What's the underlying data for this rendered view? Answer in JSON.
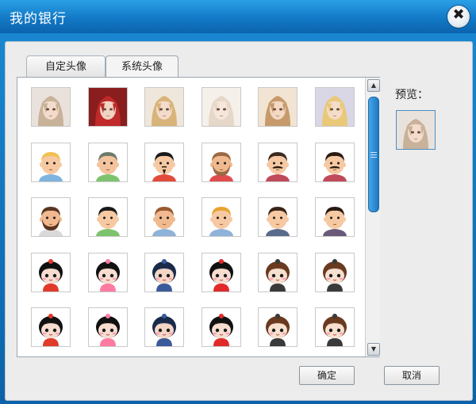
{
  "window": {
    "title": "我的银行",
    "close_glyph": "✖"
  },
  "tabs": [
    {
      "label": "自定头像",
      "active": false
    },
    {
      "label": "系统头像",
      "active": true
    }
  ],
  "preview": {
    "label": "预览："
  },
  "buttons": {
    "ok": "确定",
    "cancel": "取消"
  },
  "scrollbar": {
    "up_glyph": "▲",
    "down_glyph": "▼"
  },
  "avatars": [
    {
      "style": "anime",
      "skin": "#f3dccb",
      "hair": "#c8b29a",
      "bg": "#e9e2dc"
    },
    {
      "style": "anime",
      "skin": "#f1d3c2",
      "hair": "#c02a2a",
      "bg": "#8a1d1d"
    },
    {
      "style": "anime",
      "skin": "#f3dccb",
      "hair": "#d8b37a",
      "bg": "#efe7dc"
    },
    {
      "style": "anime",
      "skin": "#f6e6dc",
      "hair": "#e6d8c8",
      "bg": "#f5f0ea"
    },
    {
      "style": "anime",
      "skin": "#f3d9c4",
      "hair": "#c79a6c",
      "bg": "#f1e4d2"
    },
    {
      "style": "anime",
      "skin": "#f3ddc9",
      "hair": "#e9c978",
      "bg": "#d9d6e6"
    },
    {
      "style": "man",
      "skin": "#f6c9a3",
      "hair": "#f0c050",
      "shirt": "#7fb3e0",
      "facial": "none"
    },
    {
      "style": "man",
      "skin": "#f3c39d",
      "hair": "#6d7a6a",
      "shirt": "#7dc36e",
      "facial": "none"
    },
    {
      "style": "man",
      "skin": "#f6c9a3",
      "hair": "#1a1a1a",
      "shirt": "#e24b3a",
      "facial": "goatee"
    },
    {
      "style": "man",
      "skin": "#f0b98f",
      "hair": "#9a6a44",
      "shirt": "#e04c4c",
      "facial": "beard"
    },
    {
      "style": "man",
      "skin": "#f6c9a3",
      "hair": "#3a2a20",
      "shirt": "#c04a5a",
      "facial": "mustache"
    },
    {
      "style": "man",
      "skin": "#f6c9a3",
      "hair": "#2a1a12",
      "shirt": "#c04a5a",
      "facial": "mustache"
    },
    {
      "style": "man",
      "skin": "#f0b98f",
      "hair": "#5a3620",
      "shirt": "#d9d9d9",
      "facial": "beard"
    },
    {
      "style": "man",
      "skin": "#f6c9a3",
      "hair": "#1a1a1a",
      "shirt": "#7dc36e",
      "facial": "none"
    },
    {
      "style": "man",
      "skin": "#f0b98f",
      "hair": "#9a5a30",
      "shirt": "#8fb2d8",
      "facial": "none"
    },
    {
      "style": "man",
      "skin": "#f6c9a3",
      "hair": "#e8a330",
      "shirt": "#8fb2d8",
      "facial": "none"
    },
    {
      "style": "man",
      "skin": "#f6c9a3",
      "hair": "#3a2418",
      "shirt": "#5a6a8a",
      "facial": "none"
    },
    {
      "style": "man",
      "skin": "#f6c9a3",
      "hair": "#2a1a12",
      "shirt": "#6a5a7a",
      "facial": "none"
    },
    {
      "style": "chibi",
      "skin": "#f7ddd0",
      "hair": "#111111",
      "accent": "#e03a2a",
      "bg": "#ffffff"
    },
    {
      "style": "chibi",
      "skin": "#f7ddd0",
      "hair": "#111111",
      "accent": "#ff7aa0",
      "bg": "#ffffff"
    },
    {
      "style": "chibi",
      "skin": "#f4d6c6",
      "hair": "#1a2a4a",
      "accent": "#3a5a9a",
      "bg": "#ffffff"
    },
    {
      "style": "chibi",
      "skin": "#f7ddd0",
      "hair": "#111111",
      "accent": "#e02a2a",
      "bg": "#ffffff"
    },
    {
      "style": "chibi",
      "skin": "#f7e0cf",
      "hair": "#6a3a20",
      "accent": "#3a3a3a",
      "bg": "#ffffff"
    },
    {
      "style": "chibi",
      "skin": "#f7e0cf",
      "hair": "#6a3a20",
      "accent": "#3a3a3a",
      "bg": "#ffffff"
    },
    {
      "style": "chibi",
      "skin": "#f7ddd0",
      "hair": "#111111",
      "accent": "#e03a2a",
      "bg": "#ffffff"
    },
    {
      "style": "chibi",
      "skin": "#f7ddd0",
      "hair": "#111111",
      "accent": "#ff7aa0",
      "bg": "#ffffff"
    },
    {
      "style": "chibi",
      "skin": "#f4d6c6",
      "hair": "#1a2a4a",
      "accent": "#3a5a9a",
      "bg": "#ffffff"
    },
    {
      "style": "chibi",
      "skin": "#f7ddd0",
      "hair": "#111111",
      "accent": "#e02a2a",
      "bg": "#ffffff"
    },
    {
      "style": "chibi",
      "skin": "#f7e0cf",
      "hair": "#6a3a20",
      "accent": "#3a3a3a",
      "bg": "#ffffff"
    },
    {
      "style": "chibi",
      "skin": "#f7e0cf",
      "hair": "#6a3a20",
      "accent": "#3a3a3a",
      "bg": "#ffffff"
    }
  ],
  "selected_avatar_index": 0
}
